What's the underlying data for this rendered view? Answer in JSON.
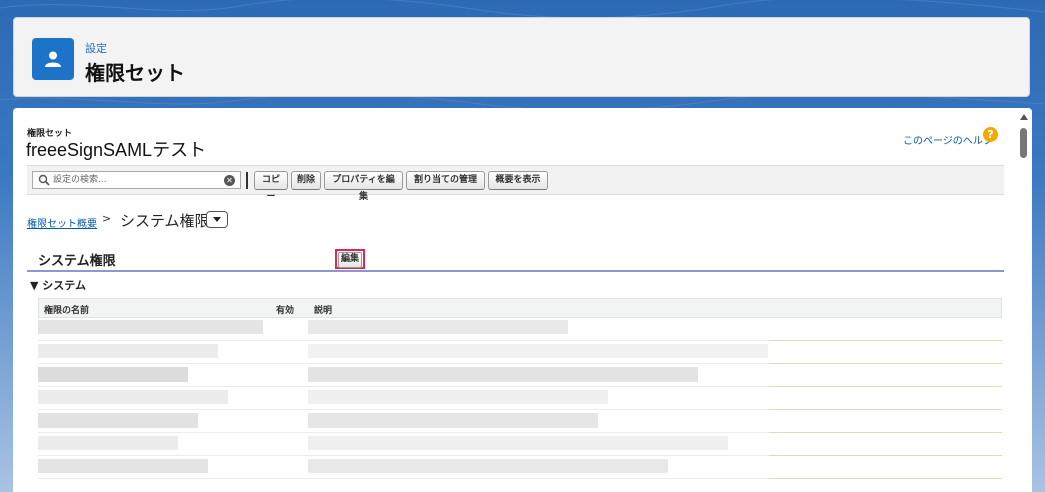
{
  "header": {
    "eyebrow": "設定",
    "title": "権限セット",
    "icon": "user-icon"
  },
  "record": {
    "eyebrow": "権限セット",
    "name": "freeeSignSAMLテスト",
    "help_link": "このページのヘルプ",
    "help_icon": "?"
  },
  "toolbar": {
    "search_placeholder": "設定の検索...",
    "buttons": [
      "コピー",
      "削除",
      "プロパティを編集",
      "割り当ての管理",
      "概要を表示"
    ]
  },
  "breadcrumb": {
    "link": "権限セット概要",
    "separator": ">",
    "current": "システム権限"
  },
  "section": {
    "title": "システム権限",
    "edit_label": "編集",
    "subsection": "▼ システム"
  },
  "table": {
    "columns": [
      "権限の名前",
      "有効",
      "説明"
    ]
  },
  "colors": {
    "accent": "#1d73c8",
    "highlight": "#e0245e",
    "link": "#015ba7"
  }
}
